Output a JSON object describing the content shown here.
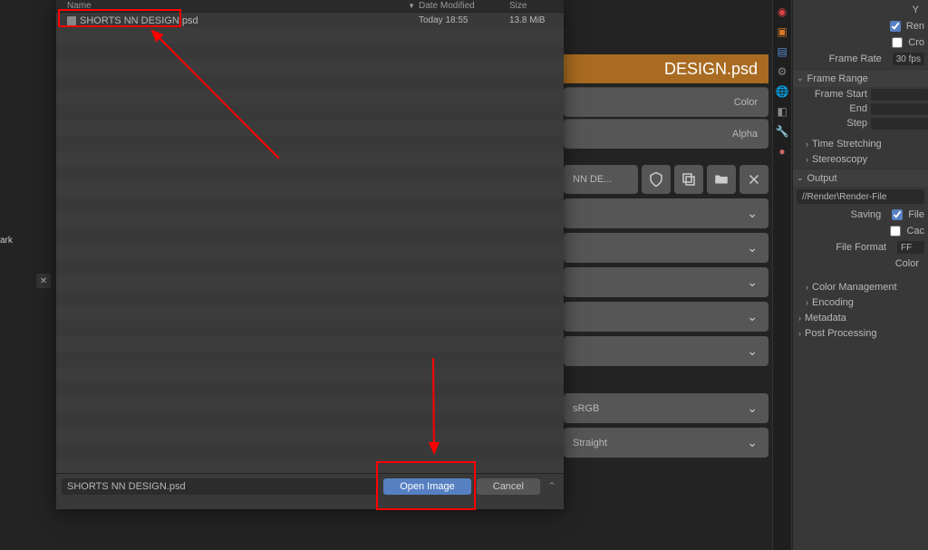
{
  "file_browser": {
    "columns": {
      "name": "Name",
      "date": "Date Modified",
      "size": "Size"
    },
    "file": {
      "name": "SHORTS NN DESIGN.psd",
      "date": "Today 18:55",
      "size": "13.8 MiB"
    },
    "filename_input": "SHORTS NN DESIGN.psd",
    "open_btn": "Open Image",
    "cancel_btn": "Cancel"
  },
  "left_fragments": {
    "ark": "ark",
    "close": "✕"
  },
  "shader_panel": {
    "title_fragment": "DESIGN.psd",
    "color": "Color",
    "alpha": "Alpha",
    "file_fragment": "NN DE...",
    "srgb": "sRGB",
    "straight": "Straight"
  },
  "props": {
    "y": "Y",
    "ren": "Ren",
    "cro": "Cro",
    "frame_rate_lbl": "Frame Rate",
    "frame_rate_val": "30 fps",
    "frame_range": "Frame Range",
    "frame_start": "Frame Start",
    "end": "End",
    "step": "Step",
    "time_stretching": "Time Stretching",
    "stereoscopy": "Stereoscopy",
    "output": "Output",
    "output_path": "//Render\\Render-File",
    "saving": "Saving",
    "file": "File",
    "cac": "Cac",
    "file_format": "File Format",
    "ff_icon": "FF",
    "color": "Color",
    "color_management": "Color Management",
    "encoding": "Encoding",
    "metadata": "Metadata",
    "post_processing": "Post Processing"
  }
}
